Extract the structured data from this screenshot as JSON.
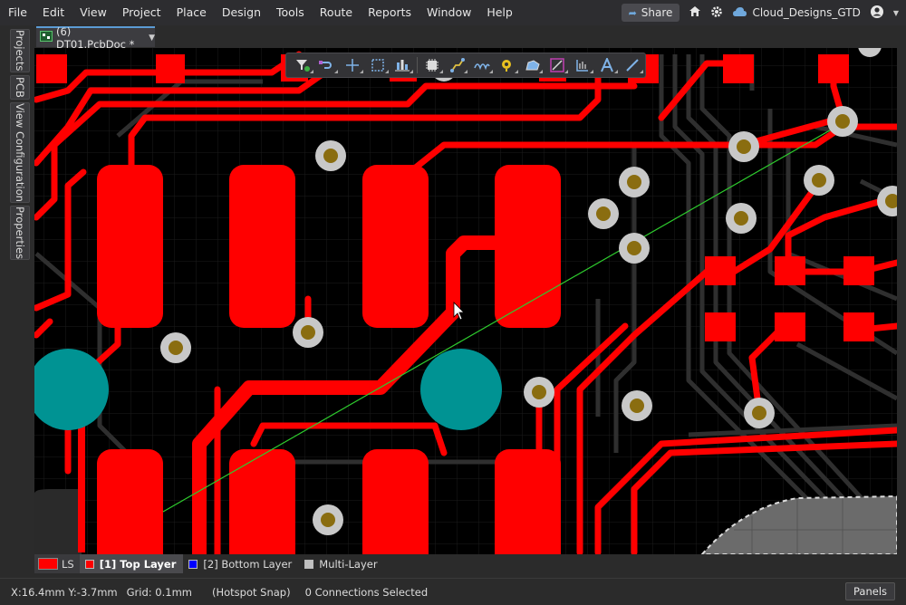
{
  "menu": [
    "File",
    "Edit",
    "View",
    "Project",
    "Place",
    "Design",
    "Tools",
    "Route",
    "Reports",
    "Window",
    "Help"
  ],
  "topbar": {
    "share_label": "Share",
    "workspace": "Cloud_Designs_GTD"
  },
  "side_panels": [
    "Projects",
    "PCB",
    "View Configuration",
    "Properties"
  ],
  "document_tab": {
    "label": "(6) DT01.PcbDoc *"
  },
  "toolbar_icons": [
    "filter-icon",
    "interactive-route-icon",
    "crosshair-icon",
    "select-rect-icon",
    "align-icon",
    "component-icon",
    "route-multiple-icon",
    "diff-pair-icon",
    "pad-via-icon",
    "polygon-icon",
    "keepout-icon",
    "dimension-icon",
    "string-text-icon",
    "line-icon"
  ],
  "layers": {
    "ls_label": "LS",
    "ls_color": "#ff0000",
    "tabs": [
      {
        "label": "[1] Top Layer",
        "color": "#ff0000"
      },
      {
        "label": "[2] Bottom Layer",
        "color": "#0000ff"
      },
      {
        "label": "Multi-Layer",
        "color": "#c0c0c0"
      }
    ]
  },
  "status": {
    "coords": "X:16.4mm Y:-3.7mm",
    "grid": "Grid: 0.1mm",
    "snap": "(Hotspot Snap)",
    "connections": "0 Connections Selected",
    "panels_label": "Panels"
  },
  "colors": {
    "top_layer": "#ff0000",
    "bottom_layer_trace": "#2f2f2f",
    "via_ring": "#c8c8c8",
    "via_hole": "#8a6d10",
    "mounting_hole": "#009393",
    "ratsnest": "#2ecc2e",
    "polygon": "#6b6b6b"
  }
}
